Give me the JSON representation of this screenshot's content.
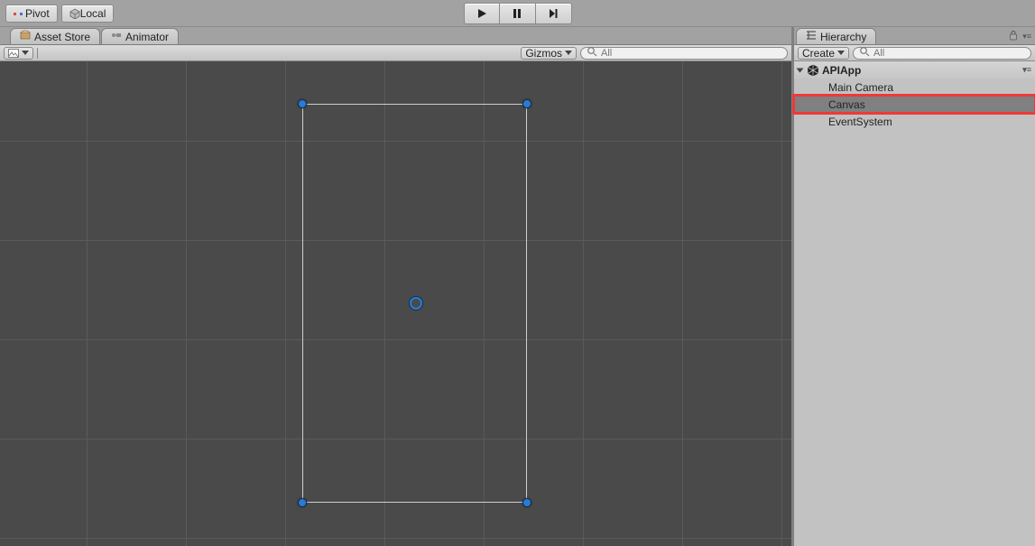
{
  "topbar": {
    "pivot_label": "Pivot",
    "local_label": "Local"
  },
  "scene": {
    "tab_asset_store": "Asset Store",
    "tab_animator": "Animator",
    "gizmos_label": "Gizmos",
    "search_placeholder": "All"
  },
  "hierarchy": {
    "tab_label": "Hierarchy",
    "create_label": "Create",
    "search_placeholder": "All",
    "scene_name": "APIApp",
    "items": [
      {
        "label": "Main Camera"
      },
      {
        "label": "Canvas"
      },
      {
        "label": "EventSystem"
      }
    ]
  }
}
